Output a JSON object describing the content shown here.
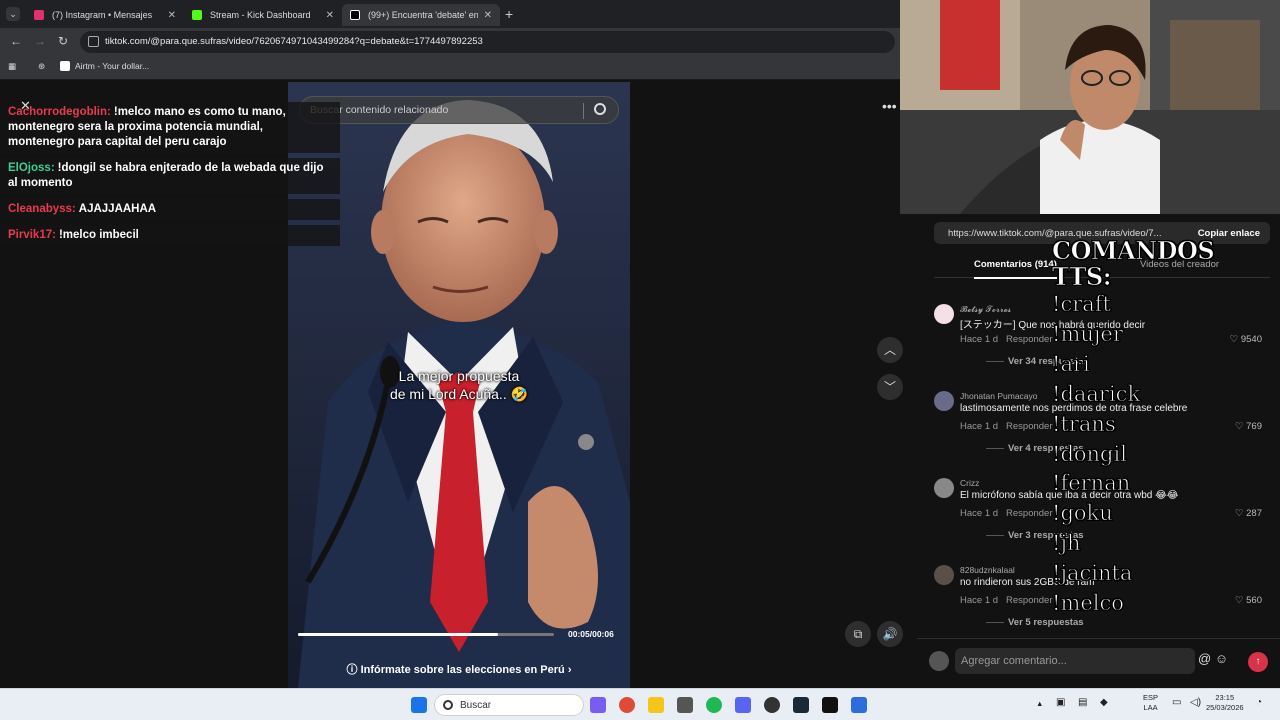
{
  "browser": {
    "tabs": [
      {
        "label": "(7) Instagram • Mensajes",
        "color": "#e1306c"
      },
      {
        "label": "Stream - Kick Dashboard",
        "color": "#53fc18"
      },
      {
        "label": "(99+) Encuentra 'debate' en",
        "color": "#ffffff"
      }
    ],
    "url": "tiktok.com/@para.que.sufras/video/7620674971043499284?q=debate&t=1774497892253",
    "bookmark": "Airtm - Your dollar..."
  },
  "search": {
    "placeholder": "Buscar contenido relacionado"
  },
  "chat": [
    {
      "user": "Cachorrodegoblin:",
      "text": "!melco mano es como tu mano, montenegro sera la proxima potencia mundial, montenegro para capital del peru carajo",
      "color": "#e8394f"
    },
    {
      "user": "ElOjoss:",
      "text": "!dongil se habra enjterado de la webada que dijo al momento",
      "color": "#3ecf8e"
    },
    {
      "user": "Cleanabyss:",
      "text": "AJAJJAAHAA",
      "color": "#e8394f"
    },
    {
      "user": "Pirvik17:",
      "text": "!melco imbecil",
      "color": "#e8394f"
    }
  ],
  "video": {
    "caption_line1": "La mejor propuesta",
    "caption_line2": "de mi Lord Acuña.. 🤣",
    "time": "00:05/00:06",
    "progress": 0.78,
    "info_link": "Infórmate sobre las elecciones en Perú",
    "info_arrow": "›"
  },
  "share": {
    "url": "https://www.tiktok.com/@para.que.sufras/video/7...",
    "copy_label": "Copiar enlace"
  },
  "comment_tabs": {
    "comments": "Comentarios (914)",
    "creator": "Videos del creador"
  },
  "comments": [
    {
      "user": "𝓑𝓮𝓽𝓼𝔂 𝓣𝓸𝓻𝓻𝓮𝓼",
      "text": "[ステッカー] Que nos habrá querido decir",
      "time": "Hace 1 d",
      "reply": "Responder",
      "likes": "9540",
      "more": "Ver 34 respuestas"
    },
    {
      "user": "Jhonatan Pumacayo",
      "text": "lastimosamente nos perdimos de otra frase celebre",
      "time": "Hace 1 d",
      "reply": "Responder",
      "likes": "769",
      "more": "Ver 4 respuestas"
    },
    {
      "user": "Crizz",
      "text": "El micrófono sabía que iba a decir otra wbd 😂😂",
      "time": "Hace 1 d",
      "reply": "Responder",
      "likes": "287",
      "more": "Ver 3 respuestas"
    },
    {
      "user": "828udznkalaal",
      "text": "no rindieron sus 2GBS de ram",
      "time": "Hace 1 d",
      "reply": "Responder",
      "likes": "560",
      "more": "Ver 5 respuestas"
    }
  ],
  "tts": {
    "title": "COMANDOS TTS:",
    "commands": [
      "!craft",
      "!mujer",
      "!ari",
      "!daarick",
      "!trans",
      "!dongil",
      "!fernan",
      "!goku",
      "!jh",
      "!jacinta",
      "!melco"
    ]
  },
  "add_comment": {
    "placeholder": "Agregar comentario..."
  },
  "taskbar": {
    "search": "Buscar",
    "lang1": "ESP",
    "lang2": "LAA",
    "time": "23:15",
    "date": "25/03/2026"
  }
}
